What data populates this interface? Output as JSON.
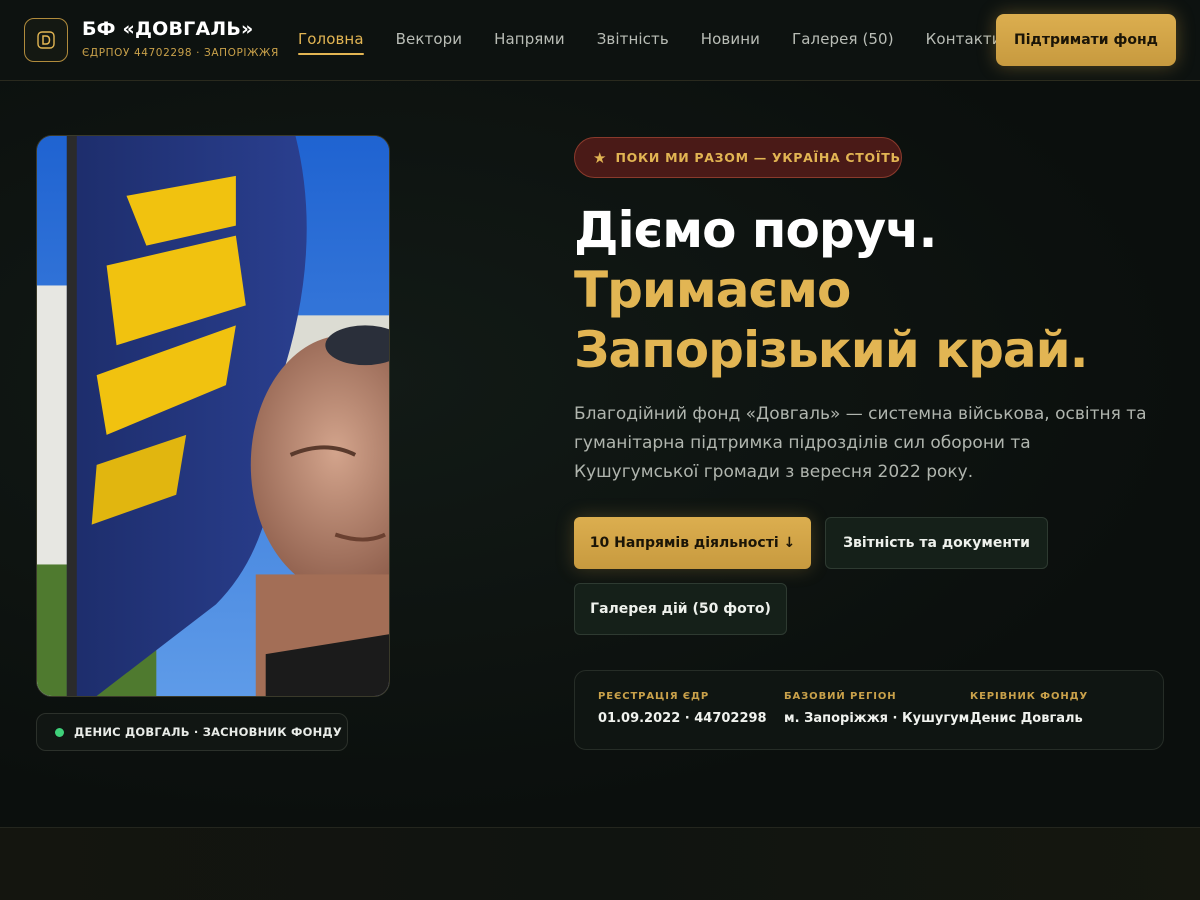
{
  "header": {
    "brand_name": "БФ «ДОВГАЛЬ»",
    "brand_sub": "ЄДРПОУ 44702298 · ЗАПОРІЖЖЯ",
    "logo_icon": "d-monogram-icon",
    "nav": [
      {
        "label": "Головна",
        "active": true
      },
      {
        "label": "Вектори"
      },
      {
        "label": "Напрями"
      },
      {
        "label": "Звітність"
      },
      {
        "label": "Новини"
      },
      {
        "label": "Галерея (50)"
      },
      {
        "label": "Контакти"
      }
    ],
    "support_label": "Підтримати фонд"
  },
  "hero": {
    "tag": "ПОКИ МИ РАЗОМ — УКРАЇНА СТОЇТЬ",
    "tag_icon": "star-icon",
    "headline_1": "Діємо поруч.",
    "headline_2": "Тримаємо",
    "headline_3": "Запорізький край.",
    "lead": "Благодійний фонд «Довгаль» — системна військова, освітня та гуманітарна підтримка підрозділів сил оборони та Кушугумської громади з вересня 2022 року.",
    "btn_directions": "10 Напрямів діяльності ↓",
    "btn_reports": "Звітність та документи",
    "btn_gallery": "Галерея дій (50 фото)",
    "photo_caption": "ДЕНИС ДОВГАЛЬ · ЗАСНОВНИК ФОНДУ"
  },
  "info": [
    {
      "label": "РЕЄСТРАЦІЯ ЄДР",
      "value": "01.09.2022 · 44702298"
    },
    {
      "label": "БАЗОВИЙ РЕГІОН",
      "value": "м. Запоріжжя · Кушугум"
    },
    {
      "label": "КЕРІВНИК ФОНДУ",
      "value": "Денис Довгаль"
    }
  ],
  "colors": {
    "accent": "#e2b553",
    "background": "#0b0f0d",
    "tag_bg": "#4a1a17",
    "status_dot": "#3fd17a"
  }
}
